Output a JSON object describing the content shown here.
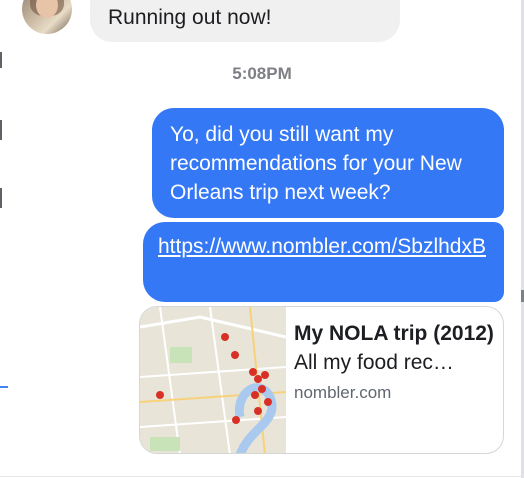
{
  "conversation": {
    "incoming_message": "Running out now!",
    "timestamp": "5:08PM",
    "outgoing_text": "Yo, did you still want my recommendations for your New Orleans trip next week?",
    "outgoing_link": "https://www.nombler.com/SbzlhdxB"
  },
  "link_preview": {
    "title": "My NOLA trip (2012)",
    "description": "All my food rec…",
    "domain": "nombler.com",
    "thumbnail_icon": "map-thumbnail"
  },
  "colors": {
    "outgoing_bubble": "#3478f6",
    "incoming_bubble": "#f1f0f0",
    "timestamp_text": "#7d7f84",
    "map_pin": "#d93025"
  }
}
